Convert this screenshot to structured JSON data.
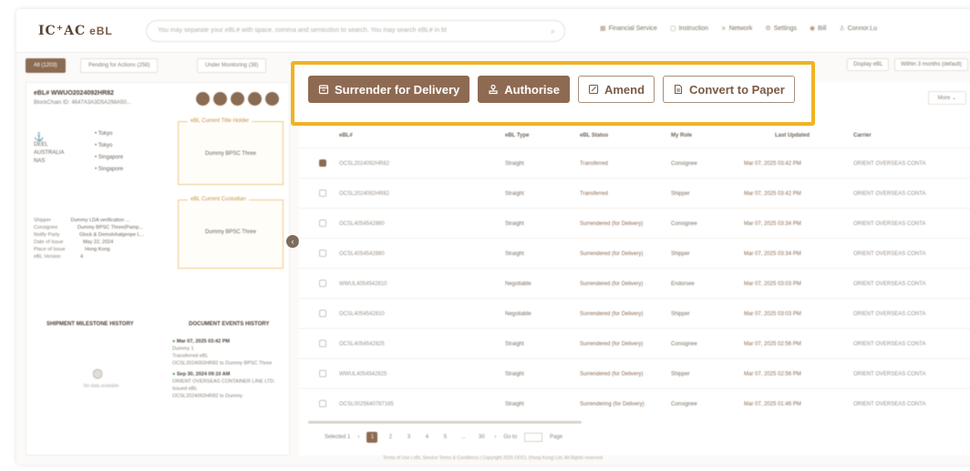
{
  "header": {
    "logo_mark": "IC⁺AC",
    "logo_suffix": "eBL",
    "search_placeholder": "You may separate your eBL# with space, comma and semicolon to search. You may search eBL# in bt",
    "nav": [
      "Financial Service",
      "Instruction",
      "Network",
      "Settings",
      "Bill",
      "Connor.Lu"
    ]
  },
  "tabs": {
    "items": [
      "All (1203)",
      "Pending for Actions (258)",
      "Under Monitoring (38)"
    ],
    "filters": [
      "Display eBL",
      "Within 3 months (default)"
    ]
  },
  "detail": {
    "ebl_ref": "eBL# WWUO2024092HR82",
    "blockchain_ref": "BlockChain ID: 4647A3A3D5A298A50...",
    "route_from": [
      "DEEL",
      "AUSTRALIA",
      "NAS"
    ],
    "stops": [
      "Tokyo",
      "Tokyo",
      "Singapore",
      "Singapore"
    ],
    "holder_title": "eBL Current Title Holder",
    "holder_value": "Dummy BPSC Three",
    "custodian_title": "eBL Current Custodian",
    "custodian_value": "Dummy BPSC Three",
    "fields": [
      {
        "label": "Shipper",
        "value": "Dummy LDA verification ..."
      },
      {
        "label": "Consignee",
        "value": "Dummy BPSC Three(Pamp..."
      },
      {
        "label": "Notify Party",
        "value": "Glock & Demolvhalgenpe L..."
      },
      {
        "label": "Date of Issue",
        "value": "May 22, 2024"
      },
      {
        "label": "Place of Issue",
        "value": "Hong Kong"
      },
      {
        "label": "eBL Version",
        "value": "4"
      }
    ],
    "milestone_heading": "SHIPMENT MILESTONE HISTORY",
    "events_heading": "DOCUMENT EVENTS HISTORY",
    "no_data": "No data available",
    "events": [
      {
        "time": "Mar 07, 2025 03:42 PM",
        "lines": [
          "Dummy 1",
          "Transferred eBL",
          "OCSL2024092HR82 to Dummy BPSC Three"
        ]
      },
      {
        "time": "Sep 30, 2024 09:10 AM",
        "lines": [
          "ORIENT OVERSEAS CONTAINER LINE LTD. Issued eBL",
          "OCSL2024092HR82 to Dummy"
        ]
      }
    ]
  },
  "actions": {
    "surrender": "Surrender for Delivery",
    "authorise": "Authorise",
    "amend": "Amend",
    "convert": "Convert to Paper"
  },
  "table": {
    "more": "More",
    "headers": [
      "eBL#",
      "eBL Type",
      "eBL Status",
      "My Role",
      "Last Updated",
      "Carrier"
    ],
    "rows": [
      {
        "id": "OCSL2024092HR82",
        "type": "Straight",
        "status": "Transferred",
        "role": "Consignee",
        "time": "Mar 07, 2025 03:42 PM",
        "carrier": "ORIENT OVERSEAS CONTA",
        "checked": true
      },
      {
        "id": "OCSL2024092HR82",
        "type": "Straight",
        "status": "Transferred",
        "role": "Shipper",
        "time": "Mar 07, 2025 03:42 PM",
        "carrier": "ORIENT OVERSEAS CONTA",
        "checked": false
      },
      {
        "id": "OCSL4054542860",
        "type": "Straight",
        "status": "Surrendered (for Delivery)",
        "role": "Consignee",
        "time": "Mar 07, 2025 03:34 PM",
        "carrier": "ORIENT OVERSEAS CONTA",
        "checked": false
      },
      {
        "id": "OCSL4054542860",
        "type": "Straight",
        "status": "Surrendered (for Delivery)",
        "role": "Shipper",
        "time": "Mar 07, 2025 03:34 PM",
        "carrier": "ORIENT OVERSEAS CONTA",
        "checked": false
      },
      {
        "id": "WWUL4054542810",
        "type": "Negotiable",
        "status": "Surrendered (for Delivery)",
        "role": "Endorsee",
        "time": "Mar 07, 2025 03:03 PM",
        "carrier": "ORIENT OVERSEAS CONTA",
        "checked": false
      },
      {
        "id": "OCSL4054542810",
        "type": "Negotiable",
        "status": "Surrendered (for Delivery)",
        "role": "Shipper",
        "time": "Mar 07, 2025 03:03 PM",
        "carrier": "ORIENT OVERSEAS CONTA",
        "checked": false
      },
      {
        "id": "OCSL4054542825",
        "type": "Straight",
        "status": "Surrendered (for Delivery)",
        "role": "Consignee",
        "time": "Mar 07, 2025 02:56 PM",
        "carrier": "ORIENT OVERSEAS CONTA",
        "checked": false
      },
      {
        "id": "WWUL4054542825",
        "type": "Straight",
        "status": "Surrendered (for Delivery)",
        "role": "Shipper",
        "time": "Mar 07, 2025 02:56 PM",
        "carrier": "ORIENT OVERSEAS CONTA",
        "checked": false
      },
      {
        "id": "OCSL0025640787165",
        "type": "Straight",
        "status": "Surrendering (for Delivery)",
        "role": "Consignee",
        "time": "Mar 07, 2025 01:46 PM",
        "carrier": "ORIENT OVERSEAS CONTA",
        "checked": false
      }
    ],
    "pager": {
      "selected": "Selected 1",
      "pages": [
        "1",
        "2",
        "3",
        "4",
        "5",
        "...",
        "30"
      ],
      "goto": "Go to",
      "page": "Page"
    }
  },
  "footer": "Terms of Use | eBL Service Terms & Conditions | Copyright 2025 OOCL (Hong Kong) Ltd. All Rights reserved",
  "colors": {
    "accent": "#8e6a52",
    "highlight": "#f0b323"
  }
}
